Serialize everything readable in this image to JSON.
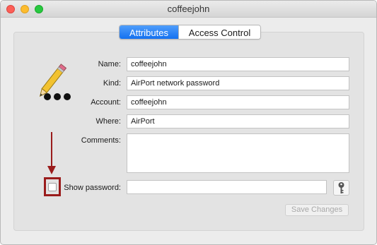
{
  "window": {
    "title": "coffeejohn"
  },
  "tabs": [
    {
      "label": "Attributes",
      "active": true
    },
    {
      "label": "Access Control",
      "active": false
    }
  ],
  "icons": {
    "item_icon": "pencil-dots-icon",
    "key_icon": "key-icon",
    "annotation_arrow": "red-down-arrow"
  },
  "form": {
    "name": {
      "label": "Name:",
      "value": "coffeejohn"
    },
    "kind": {
      "label": "Kind:",
      "value": "AirPort network password"
    },
    "account": {
      "label": "Account:",
      "value": "coffeejohn"
    },
    "where": {
      "label": "Where:",
      "value": "AirPort"
    },
    "comments": {
      "label": "Comments:",
      "value": ""
    },
    "show_password": {
      "label": "Show password:",
      "checked": false,
      "value": ""
    }
  },
  "buttons": {
    "save_changes": "Save Changes"
  },
  "colors": {
    "accent_blue": "#1471f0",
    "annotation_red": "#9a1c1c",
    "close": "#fc5f57",
    "minimize": "#fdbc2e",
    "maximize": "#28c840"
  }
}
